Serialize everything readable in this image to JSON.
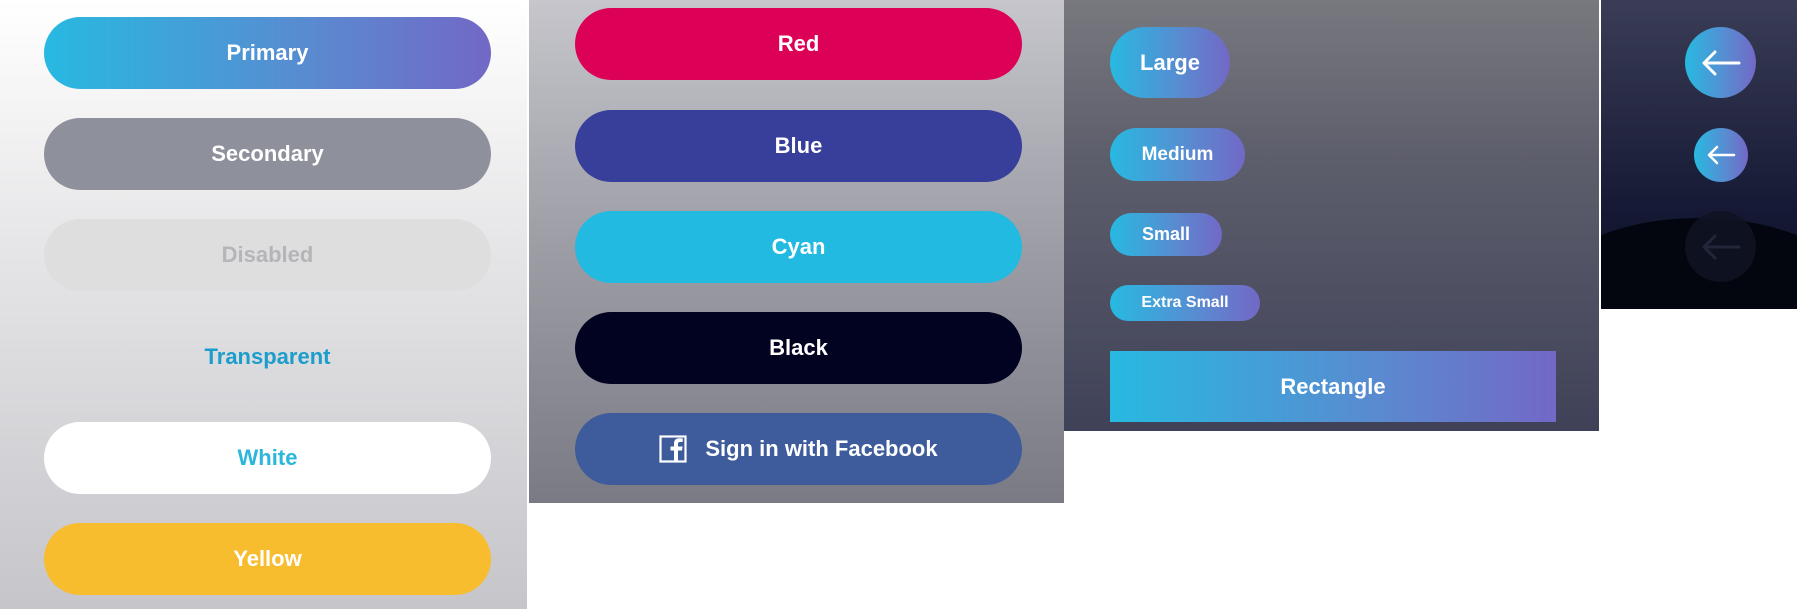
{
  "colors": {
    "gradient_start": "#27b9e1",
    "gradient_end": "#7268c6",
    "secondary": "#8e909b",
    "disabled_bg": "#dedede",
    "disabled_text": "#b5b5b9",
    "transparent_text": "#1c9dcb",
    "white_text": "#2bb6dc",
    "yellow": "#f7bd2e",
    "red": "#dc0057",
    "blue": "#373f9a",
    "cyan": "#23bae1",
    "black": "#020321",
    "facebook": "#3e5c9b"
  },
  "variants_panel": {
    "primary": "Primary",
    "secondary": "Secondary",
    "disabled": "Disabled",
    "transparent": "Transparent",
    "white": "White",
    "yellow": "Yellow"
  },
  "colors_panel": {
    "red": "Red",
    "blue": "Blue",
    "cyan": "Cyan",
    "black": "Black",
    "facebook": "Sign in with Facebook",
    "facebook_icon": "facebook-icon"
  },
  "sizes_panel": {
    "large": "Large",
    "medium": "Medium",
    "small": "Small",
    "extra_small": "Extra Small",
    "rectangle": "Rectangle"
  },
  "round_panel": {
    "icon": "arrow-left-icon"
  }
}
